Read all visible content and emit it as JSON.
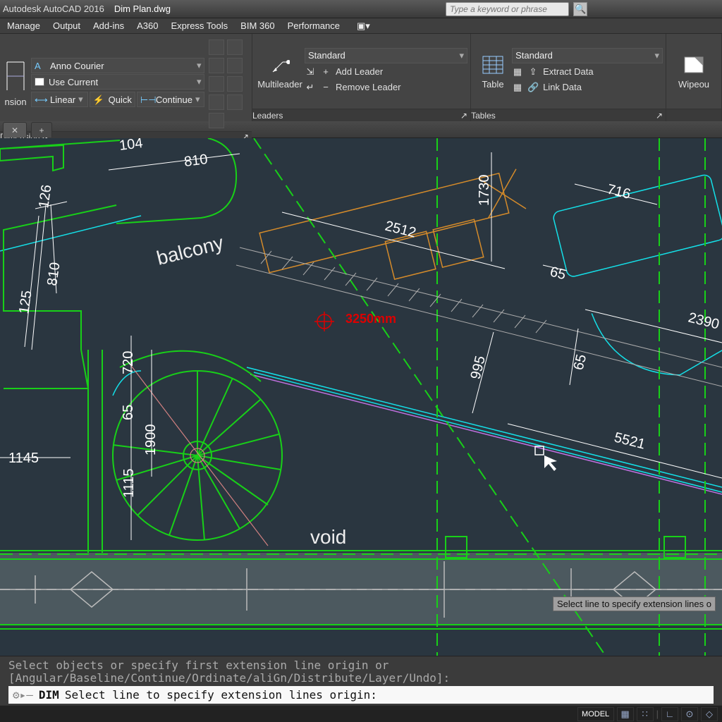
{
  "title": {
    "app": "Autodesk AutoCAD 2016",
    "file": "Dim Plan.dwg"
  },
  "search": {
    "placeholder": "Type a keyword or phrase"
  },
  "menu": {
    "items": [
      "Manage",
      "Output",
      "Add-ins",
      "A360",
      "Express Tools",
      "BIM 360",
      "Performance"
    ]
  },
  "ribbon": {
    "dim_panel": {
      "big_label": "nsion",
      "text_style": "Anno Courier",
      "layer": "Use Current",
      "linear": "Linear",
      "quick": "Quick",
      "cont": "Continue",
      "title": "Dimensions"
    },
    "leaders_panel": {
      "big_label": "Multileader",
      "style": "Standard",
      "add": "Add Leader",
      "remove": "Remove Leader",
      "title": "Leaders"
    },
    "tables_panel": {
      "big_label": "Table",
      "style": "Standard",
      "extract": "Extract Data",
      "link": "Link Data",
      "title": "Tables"
    },
    "wipeout": {
      "label": "Wipeou"
    }
  },
  "drawing": {
    "labels": {
      "balcony": "balcony",
      "void": "void"
    },
    "annotation": "3250mm",
    "dims": {
      "d810a": "810",
      "d126": "126",
      "d810b": "810",
      "d125": "125",
      "d720": "720",
      "d65a": "65",
      "d1900": "1900",
      "d1115": "1115",
      "d1145": "1145",
      "d2512": "2512",
      "d1730": "1730",
      "d716": "716",
      "d65b": "65",
      "d2390": "2390",
      "d995": "995",
      "d65c": "65",
      "d5521": "5521",
      "d104": "104"
    }
  },
  "tooltip": "Select line to specify extension lines o",
  "command": {
    "history": "Select objects or specify first extension line origin or [Angular/Baseline/Continue/Ordinate/aliGn/Distribute/Layer/Undo]:",
    "cmd": "DIM",
    "prompt": "Select line to specify extension lines origin:"
  },
  "status": {
    "model": "MODEL"
  }
}
